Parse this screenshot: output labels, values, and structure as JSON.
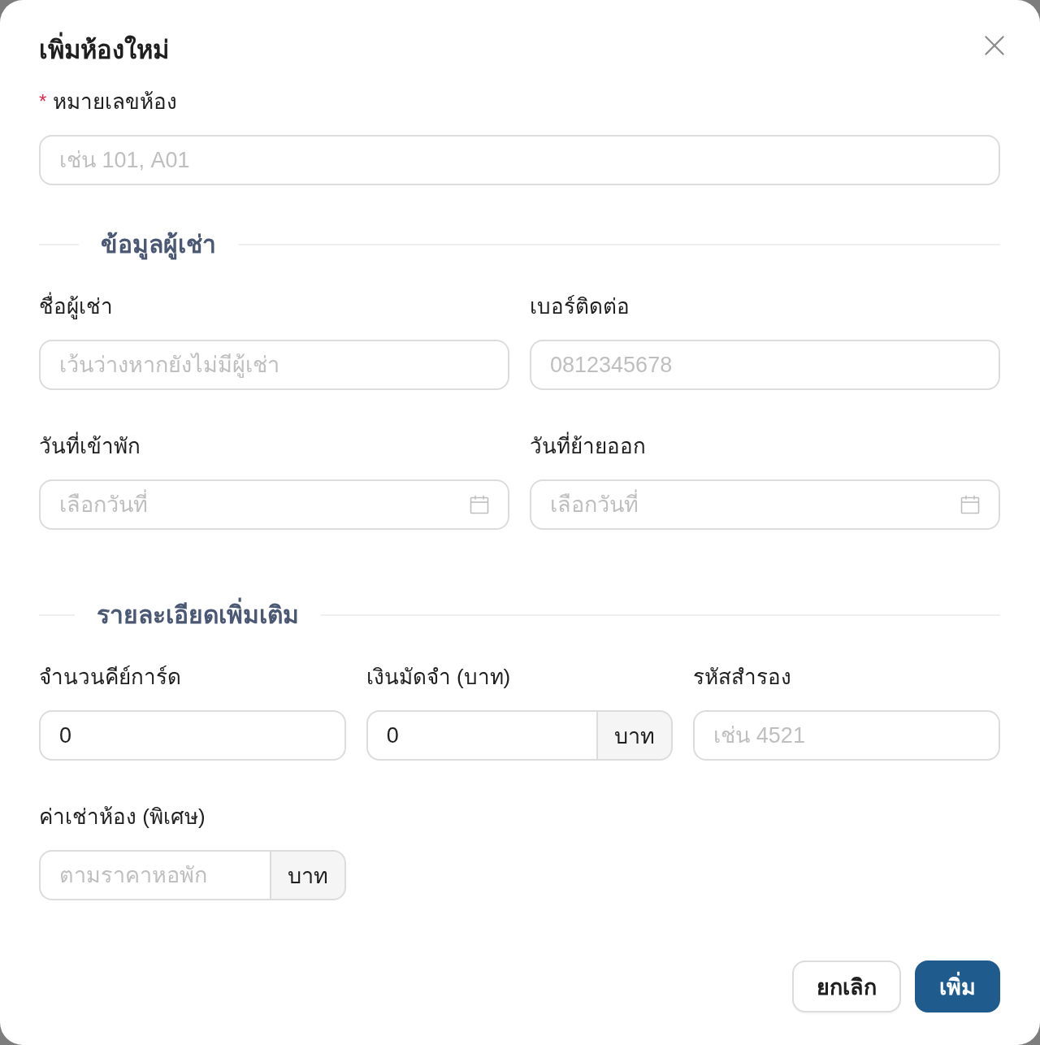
{
  "dialog": {
    "title": "เพิ่มห้องใหม่"
  },
  "room_field": {
    "label": "หมายเลขห้อง",
    "required_mark": "*",
    "kind": "text",
    "placeholder": "เช่น 101, A01"
  },
  "sections": [
    {
      "title": "ข้อมูลผู้เช่า",
      "rows": [
        [
          {
            "label": "ชื่อผู้เช่า",
            "kind": "text",
            "placeholder": "เว้นว่างหากยังไม่มีผู้เช่า"
          },
          {
            "label": "เบอร์ติดต่อ",
            "kind": "text",
            "placeholder": "0812345678"
          }
        ],
        [
          {
            "label": "วันที่เข้าพัก",
            "kind": "date",
            "placeholder": "เลือกวันที่"
          },
          {
            "label": "วันที่ย้ายออก",
            "kind": "date",
            "placeholder": "เลือกวันที่"
          }
        ]
      ]
    },
    {
      "title": "รายละเอียดเพิ่มเติม",
      "rows": [
        [
          {
            "label": "จำนวนคีย์การ์ด",
            "kind": "text",
            "value": "0"
          },
          {
            "label": "เงินมัดจำ (บาท)",
            "kind": "suffix",
            "value": "0",
            "suffix": "บาท"
          },
          {
            "label": "รหัสสำรอง",
            "kind": "text",
            "placeholder": "เช่น 4521"
          }
        ],
        [
          {
            "label": "ค่าเช่าห้อง (พิเศษ)",
            "kind": "suffix",
            "placeholder": "ตามราคาหอพัก",
            "suffix": "บาท"
          }
        ]
      ]
    }
  ],
  "buttons": [
    {
      "label": "ยกเลิก",
      "kind": "secondary"
    },
    {
      "label": "เพิ่ม",
      "kind": "primary"
    }
  ]
}
